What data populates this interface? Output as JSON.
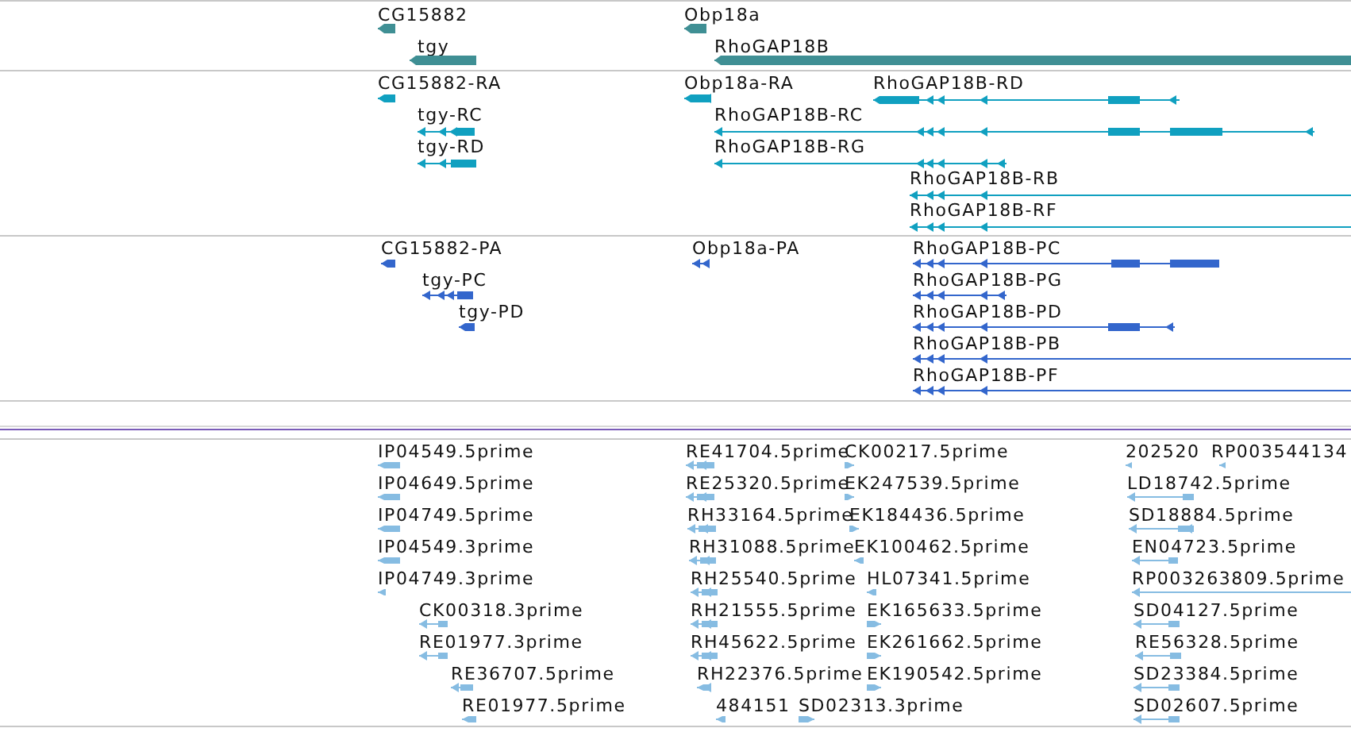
{
  "tracks": [
    {
      "color": "#3f8f94",
      "features": [
        {
          "label": "CG15882"
        },
        {
          "label": "tgy"
        },
        {
          "label": "Obp18a"
        },
        {
          "label": "RhoGAP18B"
        }
      ]
    },
    {
      "color": "#10a0c0",
      "features": [
        {
          "label": "CG15882-RA"
        },
        {
          "label": "tgy-RC"
        },
        {
          "label": "tgy-RD"
        },
        {
          "label": "Obp18a-RA"
        },
        {
          "label": "RhoGAP18B-RD"
        },
        {
          "label": "RhoGAP18B-RC"
        },
        {
          "label": "RhoGAP18B-RG"
        },
        {
          "label": "RhoGAP18B-RB"
        },
        {
          "label": "RhoGAP18B-RF"
        }
      ]
    },
    {
      "color": "#3366cc",
      "features": [
        {
          "label": "CG15882-PA"
        },
        {
          "label": "tgy-PC"
        },
        {
          "label": "tgy-PD"
        },
        {
          "label": "Obp18a-PA"
        },
        {
          "label": "RhoGAP18B-PC"
        },
        {
          "label": "RhoGAP18B-PG"
        },
        {
          "label": "RhoGAP18B-PD"
        },
        {
          "label": "RhoGAP18B-PB"
        },
        {
          "label": "RhoGAP18B-PF"
        }
      ]
    },
    {
      "color": "#86bce2",
      "features": [
        {
          "label": "IP04549.5prime"
        },
        {
          "label": "IP04649.5prime"
        },
        {
          "label": "IP04749.5prime"
        },
        {
          "label": "IP04549.3prime"
        },
        {
          "label": "IP04749.3prime"
        },
        {
          "label": "CK00318.3prime"
        },
        {
          "label": "RE01977.3prime"
        },
        {
          "label": "RE36707.5prime"
        },
        {
          "label": "RE01977.5prime"
        },
        {
          "label": "RE41704.5prime"
        },
        {
          "label": "RE25320.5prime"
        },
        {
          "label": "RH33164.5prime"
        },
        {
          "label": "RH31088.5prime"
        },
        {
          "label": "RH25540.5prime"
        },
        {
          "label": "RH21555.5prime"
        },
        {
          "label": "RH45622.5prime"
        },
        {
          "label": "RH22376.5prime"
        },
        {
          "label": "484151"
        },
        {
          "label": "SD02313.3prime"
        },
        {
          "label": "CK00217.5prime"
        },
        {
          "label": "EK247539.5prime"
        },
        {
          "label": "EK184436.5prime"
        },
        {
          "label": "EK100462.5prime"
        },
        {
          "label": "HL07341.5prime"
        },
        {
          "label": "EK165633.5prime"
        },
        {
          "label": "EK261662.5prime"
        },
        {
          "label": "EK190542.5prime"
        },
        {
          "label": "202520"
        },
        {
          "label": "RP003544134"
        },
        {
          "label": "LD18742.5prime"
        },
        {
          "label": "SD18884.5prime"
        },
        {
          "label": "EN04723.5prime"
        },
        {
          "label": "RP003263809.5prime"
        },
        {
          "label": "SD04127.5prime"
        },
        {
          "label": "RE56328.5prime"
        },
        {
          "label": "SD23384.5prime"
        },
        {
          "label": "SD02607.5prime"
        }
      ]
    }
  ]
}
